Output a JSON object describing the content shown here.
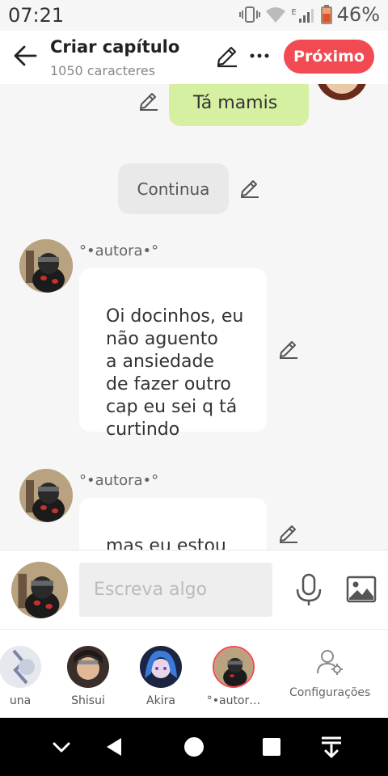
{
  "status_bar": {
    "time": "07:21",
    "battery_percent": "46%",
    "network": "E"
  },
  "header": {
    "title": "Criar capítulo",
    "subtitle": "1050 caracteres",
    "next_label": "Próximo"
  },
  "chat": {
    "messages": [
      {
        "type": "sent",
        "text": "Tá mamis"
      },
      {
        "type": "narration",
        "text": "Continua"
      },
      {
        "type": "received",
        "sender": "°•autora•°",
        "text": "Oi docinhos, eu\nnão aguento\na ansiedade\nde fazer outro\ncap eu sei q tá\ncurtindo"
      },
      {
        "type": "received",
        "sender": "°•autora•°",
        "text": "mas eu estou\ncom sono kkk"
      }
    ]
  },
  "composer": {
    "placeholder": "Escreva algo"
  },
  "characters": [
    {
      "name": "una"
    },
    {
      "name": "Shisui"
    },
    {
      "name": "Akira"
    },
    {
      "name": "°•autor…"
    }
  ],
  "settings_label": "Configurações",
  "colors": {
    "accent": "#f24a52",
    "sent_bubble": "#d4f0a0"
  }
}
